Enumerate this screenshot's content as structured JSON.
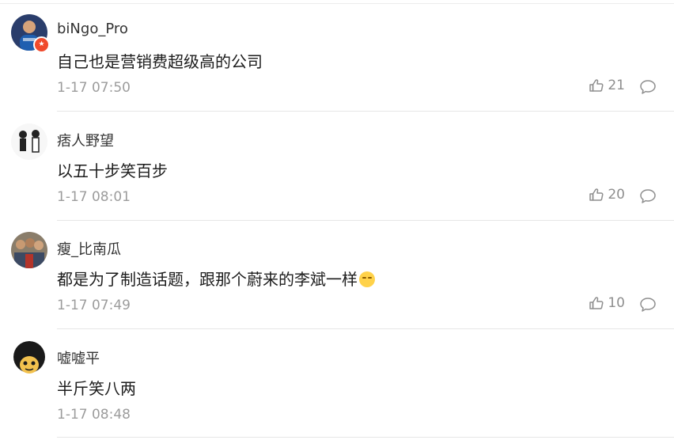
{
  "comments": [
    {
      "username": "biNgo_Pro",
      "content": "自己也是营销费超级高的公司",
      "time": "1-17 07:50",
      "likes": "21",
      "avatar": "avatar-blue-player",
      "verified_badge": true
    },
    {
      "username": "痞人野望",
      "content": "以五十步笑百步",
      "time": "1-17 08:01",
      "likes": "20",
      "avatar": "avatar-sketch-figures"
    },
    {
      "username": "瘦_比南瓜",
      "content": "都是为了制造话题，跟那个蔚来的李斌一样",
      "emoji": "smile-emoji",
      "time": "1-17 07:49",
      "likes": "10",
      "avatar": "avatar-group-photo"
    },
    {
      "username": "嘘嘘平",
      "content": "半斤笑八两",
      "time": "1-17 08:48",
      "likes": "",
      "avatar": "avatar-afro-cartoon"
    }
  ],
  "colors": {
    "username": "#333333",
    "meta": "#9c9c9c",
    "divider": "#e6e6e6",
    "badge": "#f04a2c"
  },
  "icons": {
    "like": "thumbs-up-icon",
    "reply": "comment-bubble-icon"
  }
}
